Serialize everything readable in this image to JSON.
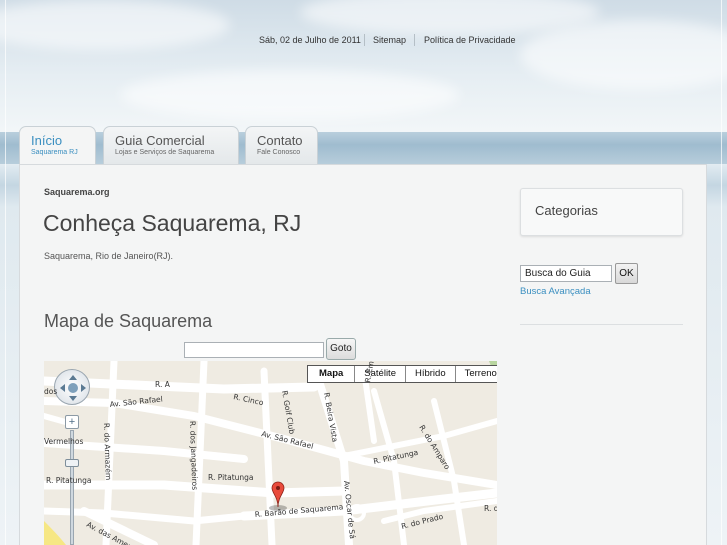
{
  "header": {
    "date": "Sáb, 02 de Julho de 2011",
    "sitemap": "Sitemap",
    "privacy": "Política de Privacidade"
  },
  "tabs": [
    {
      "title": "Início",
      "subtitle": "Saquarema RJ"
    },
    {
      "title": "Guia Comercial",
      "subtitle": "Lojas e Serviços de Saquarema"
    },
    {
      "title": "Contato",
      "subtitle": "Fale Conosco"
    }
  ],
  "main": {
    "site_label": "Saquarema.org",
    "title": "Conheça Saquarema, RJ",
    "location": "Saquarema, Rio de Janeiro(RJ).",
    "map_heading": "Mapa de Saquarema",
    "goto_label": "Goto"
  },
  "map": {
    "types": [
      "Mapa",
      "Satélite",
      "Híbrido",
      "Terreno"
    ],
    "streets": [
      "R. A",
      "Av. São Rafael",
      "R. Cinco",
      "R. Golf Club",
      "R. Beira Vista",
      "R. Em",
      "R. dos Jangadeiros",
      "R. do Armazém",
      "Av. São Rafael",
      "R. Pitatunga",
      "R. Pitatunga",
      "R. Pitatunga",
      "R. do Amparo",
      "R. Barão de Saquarema",
      "Av. Oscar de Sá",
      "R. do Prado",
      "R. d",
      "Av. das Amendoeiras",
      "Vermelhos",
      "dos"
    ]
  },
  "sidebar": {
    "categories_title": "Categorias",
    "search_value": "Busca do Guia",
    "ok_label": "OK",
    "advanced_search": "Busca Avançada"
  }
}
